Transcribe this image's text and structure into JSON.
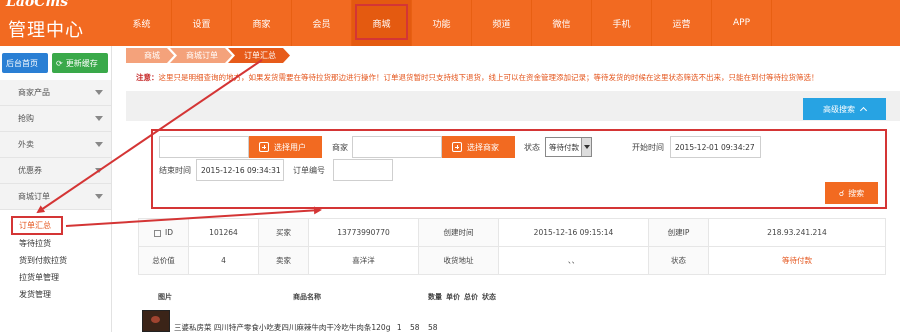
{
  "brand": {
    "logo_top": "LaoCms",
    "title": "管理中心"
  },
  "nav": {
    "items": [
      "系统",
      "设置",
      "商家",
      "会员",
      "商城",
      "功能",
      "频道",
      "微信",
      "手机",
      "运营",
      "APP"
    ],
    "active": "商城"
  },
  "sidebar": {
    "home_label": "后台首页",
    "refresh_label": "更新缓存",
    "groups": [
      "商家产品",
      "抢购",
      "外卖",
      "优惠券",
      "商城订单"
    ],
    "sub_items": [
      "订单汇总",
      "等待拉货",
      "货到付款拉货",
      "拉货单管理",
      "发货管理"
    ],
    "active_sub": "订单汇总"
  },
  "breadcrumb": [
    "商城",
    "商城订单",
    "订单汇总"
  ],
  "notice": {
    "prefix": "注意：",
    "text": "这里只是明细查询的地方，如果发货需要在等待拉货那边进行操作！订单退货暂时只支持线下退货，线上可以在资金管理添加记录；等待发货的时候在这里状态筛选不出来，只能在到付等待拉货筛选！"
  },
  "advanced_search_label": "高级搜索",
  "filter": {
    "choose_user_label": "选择用户",
    "merchant_label": "商家",
    "choose_merchant_label": "选择商家",
    "status_label": "状态",
    "status_value": "等待付款",
    "start_time_label": "开始时间",
    "start_time_value": "2015-12-01 09:34:27",
    "end_time_label": "结束时间",
    "end_time_value": "2015-12-16 09:34:31",
    "order_no_label": "订单编号",
    "search_label": "搜索"
  },
  "order": {
    "row1": [
      "ID",
      "101264",
      "买家",
      "13773990770",
      "创建时间",
      "2015-12-16 09:15:14",
      "创建IP",
      "218.93.241.214"
    ],
    "row2": [
      "总价值",
      "4",
      "卖家",
      "喜洋洋",
      "收货地址",
      "、、",
      "状态",
      "等待付款"
    ],
    "goods_headers": [
      "图片",
      "商品名称",
      "数量",
      "单价",
      "总价",
      "状态"
    ],
    "goods": [
      {
        "name": "三婆私房菜 四川特产零食小吃麦四川麻辣牛肉干冷吃牛肉条120g",
        "qty": "1",
        "price": "58",
        "total": "58"
      }
    ]
  },
  "colors": {
    "brand_orange": "#f26a21",
    "annotation_red": "#d43535",
    "adv_blue": "#27a3e3"
  }
}
